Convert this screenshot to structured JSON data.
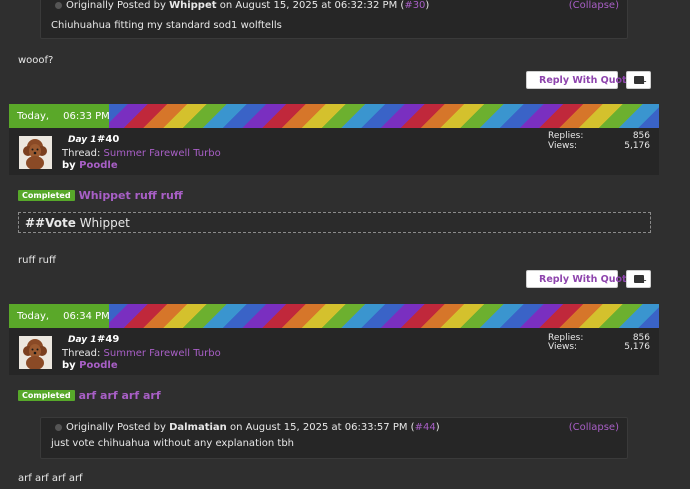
{
  "top_quote": {
    "prefix": "Originally Posted by",
    "author": "Whippet",
    "date_text": "on August 15, 2025 at 06:32:32 PM",
    "ref_open": "(",
    "ref_link": "#30",
    "ref_close": ")",
    "collapse_label": "(Collapse)",
    "body": "Chiuhuahua fitting my standard sod1 wolftells"
  },
  "post_a": {
    "text": "wooof?"
  },
  "buttons": {
    "reply_with_quote": "Reply With Quote",
    "multi_quote_plus": "+"
  },
  "post_40": {
    "date_day": "Today,",
    "date_time": "06:33 PM",
    "day_label": "Day 1",
    "number": "#40",
    "thread_label": "Thread:",
    "thread_name": "Summer Farewell Turbo",
    "by_label": "by",
    "author": "Poodle",
    "replies_label": "Replies:",
    "replies_value": "856",
    "views_label": "Views:",
    "views_value": "5,176",
    "badge": "Completed",
    "title": "Whippet ruff ruff",
    "vote_tag": "##Vote",
    "vote_target": "Whippet",
    "body": "ruff ruff"
  },
  "post_49": {
    "date_day": "Today,",
    "date_time": "06:34 PM",
    "day_label": "Day 1",
    "number": "#49",
    "thread_label": "Thread:",
    "thread_name": "Summer Farewell Turbo",
    "by_label": "by",
    "author": "Poodle",
    "replies_label": "Replies:",
    "replies_value": "856",
    "views_label": "Views:",
    "views_value": "5,176",
    "badge": "Completed",
    "title": "arf arf arf arf",
    "quote": {
      "prefix": "Originally Posted by",
      "author": "Dalmatian",
      "date_text": "on August 15, 2025 at 06:33:57 PM",
      "ref_open": "(",
      "ref_link": "#44",
      "ref_close": ")",
      "collapse_label": "(Collapse)",
      "body": "just vote chihuahua without any explanation tbh"
    },
    "body": "arf arf arf arf"
  },
  "colors": {
    "accent": "#a85fc6",
    "badge": "#57a82a",
    "background": "#2f2f2f"
  },
  "icons": {
    "quote": "quote-icon",
    "reply": "reply-quote-icon",
    "multi": "multi-quote-icon"
  }
}
